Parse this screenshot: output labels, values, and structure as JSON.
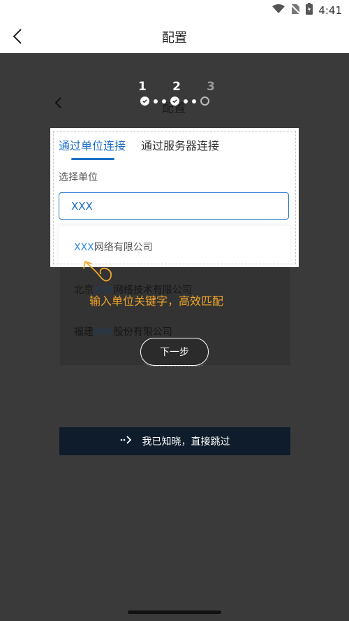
{
  "status_bar": {
    "time": "4:41"
  },
  "titlebar": {
    "title": "配置"
  },
  "steps": {
    "labels": [
      "1",
      "2",
      "3"
    ]
  },
  "ghost": {
    "title": "配置"
  },
  "tabs": {
    "unit": "通过单位连接",
    "server": "通过服务器连接"
  },
  "form": {
    "label": "选择单位",
    "input_value": "XXX"
  },
  "suggestions": [
    {
      "highlight": "XXX",
      "prefix": "",
      "suffix": "网络有限公司"
    },
    {
      "highlight": "XXX",
      "prefix": "北京",
      "suffix": "网络技术有限公司"
    },
    {
      "highlight": "XXX",
      "prefix": "福建",
      "suffix": "股份有限公司"
    }
  ],
  "annotation": {
    "text": "输入单位关键字，高效匹配"
  },
  "buttons": {
    "next": "下一步",
    "skip": "我已知晓，直接跳过"
  },
  "colors": {
    "accent": "#1f6fc8",
    "annotation": "#f0a52a",
    "overlay": "#3a3a3a",
    "skip_bg": "#0f1c2b"
  },
  "icons": [
    "wifi-icon",
    "no-sim-icon",
    "battery-icon",
    "back-arrow-icon",
    "check-icon",
    "skip-arrow-icon"
  ]
}
